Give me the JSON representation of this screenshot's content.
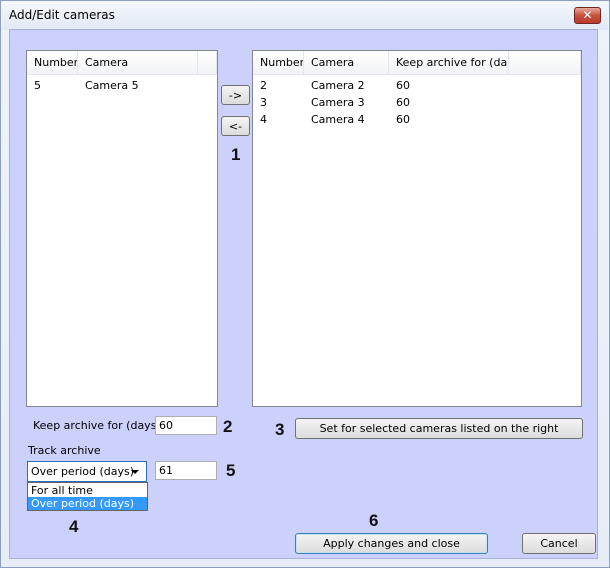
{
  "window": {
    "title": "Add/Edit cameras",
    "close_glyph": "✕"
  },
  "left_list": {
    "columns": [
      "Number",
      "Camera"
    ],
    "rows": [
      {
        "number": "5",
        "camera": "Camera 5"
      }
    ]
  },
  "right_list": {
    "columns": [
      "Number",
      "Camera",
      "Keep archive for (da..."
    ],
    "rows": [
      {
        "number": "2",
        "camera": "Camera 2",
        "keep": "60"
      },
      {
        "number": "3",
        "camera": "Camera 3",
        "keep": "60"
      },
      {
        "number": "4",
        "camera": "Camera 4",
        "keep": "60"
      }
    ]
  },
  "transfer": {
    "move_right_label": "->",
    "move_left_label": "<-"
  },
  "keep_archive": {
    "label": "Keep archive for (days)",
    "value": "60"
  },
  "set_button_label": "Set for selected cameras listed on the right",
  "track_archive": {
    "label": "Track archive",
    "selected": "Over period (days)",
    "options": [
      "For all time",
      "Over period (days)"
    ],
    "period_value": "61"
  },
  "buttons": {
    "apply_label": "Apply changes and close",
    "cancel_label": "Cancel"
  },
  "callouts": [
    "1",
    "2",
    "3",
    "4",
    "5",
    "6"
  ]
}
